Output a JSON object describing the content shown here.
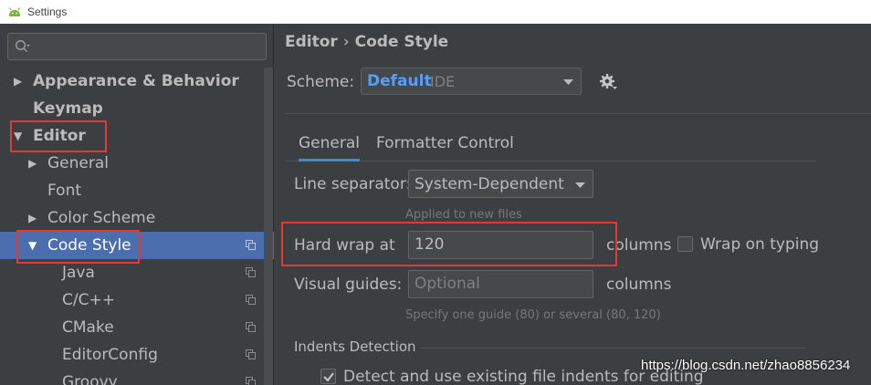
{
  "window": {
    "title": "Settings"
  },
  "sidebar": {
    "search": {
      "placeholder": ""
    },
    "tree": [
      {
        "label": "Appearance & Behavior",
        "expander": "▶"
      },
      {
        "label": "Keymap"
      },
      {
        "label": "Editor",
        "expander": "▼"
      },
      {
        "label": "General",
        "expander": "▶"
      },
      {
        "label": "Font"
      },
      {
        "label": "Color Scheme",
        "expander": "▶"
      },
      {
        "label": "Code Style",
        "expander": "▼"
      },
      {
        "label": "Java"
      },
      {
        "label": "C/C++"
      },
      {
        "label": "CMake"
      },
      {
        "label": "EditorConfig"
      },
      {
        "label": "Groovy"
      }
    ]
  },
  "main": {
    "breadcrumb": {
      "parent": "Editor",
      "separator": "›",
      "current": "Code Style"
    },
    "scheme": {
      "label": "Scheme:",
      "name": "Default",
      "kind": "IDE"
    },
    "tabs": [
      {
        "label": "General"
      },
      {
        "label": "Formatter Control"
      }
    ],
    "line_separator": {
      "label": "Line separator:",
      "value": "System-Dependent",
      "hint": "Applied to new files"
    },
    "hard_wrap": {
      "label": "Hard wrap at",
      "value": "120",
      "unit": "columns"
    },
    "wrap_on_typing": {
      "label": "Wrap on typing",
      "checked": false
    },
    "visual_guides": {
      "label": "Visual guides:",
      "placeholder": "Optional",
      "unit": "columns",
      "hint": "Specify one guide (80) or several (80, 120)"
    },
    "indents_detection": {
      "heading": "Indents Detection",
      "checkbox_label": "Detect and use existing file indents for editing",
      "checked": true
    }
  },
  "watermark": "https://blog.csdn.net/zhao8856234",
  "colors": {
    "selection": "#4b6eaf",
    "accent_blue": "#589df6",
    "highlight_red": "#e53935",
    "background": "#3c3f41"
  }
}
